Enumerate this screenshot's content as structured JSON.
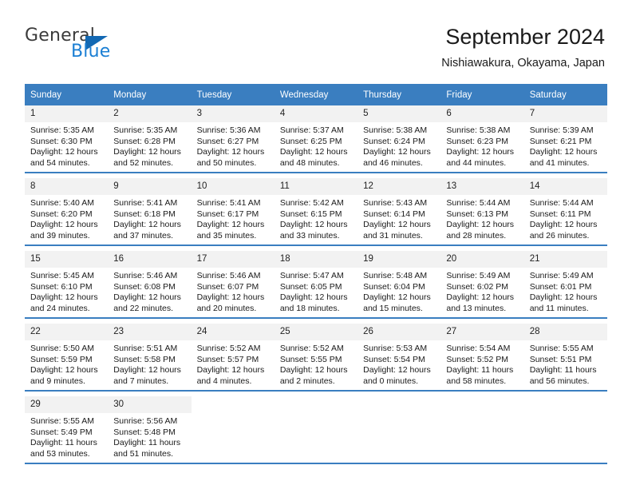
{
  "brand": {
    "name_part1": "General",
    "name_part2": "Blue",
    "triangle_icon": "triangle-icon",
    "accent_color": "#1b7fd4",
    "header_color": "#3a7ec0"
  },
  "header": {
    "title": "September 2024",
    "subtitle": "Nishiawakura, Okayama, Japan"
  },
  "weekday_headers": [
    "Sunday",
    "Monday",
    "Tuesday",
    "Wednesday",
    "Thursday",
    "Friday",
    "Saturday"
  ],
  "weeks": [
    [
      {
        "day": "1",
        "sunrise": "Sunrise: 5:35 AM",
        "sunset": "Sunset: 6:30 PM",
        "daylight1": "Daylight: 12 hours",
        "daylight2": "and 54 minutes."
      },
      {
        "day": "2",
        "sunrise": "Sunrise: 5:35 AM",
        "sunset": "Sunset: 6:28 PM",
        "daylight1": "Daylight: 12 hours",
        "daylight2": "and 52 minutes."
      },
      {
        "day": "3",
        "sunrise": "Sunrise: 5:36 AM",
        "sunset": "Sunset: 6:27 PM",
        "daylight1": "Daylight: 12 hours",
        "daylight2": "and 50 minutes."
      },
      {
        "day": "4",
        "sunrise": "Sunrise: 5:37 AM",
        "sunset": "Sunset: 6:25 PM",
        "daylight1": "Daylight: 12 hours",
        "daylight2": "and 48 minutes."
      },
      {
        "day": "5",
        "sunrise": "Sunrise: 5:38 AM",
        "sunset": "Sunset: 6:24 PM",
        "daylight1": "Daylight: 12 hours",
        "daylight2": "and 46 minutes."
      },
      {
        "day": "6",
        "sunrise": "Sunrise: 5:38 AM",
        "sunset": "Sunset: 6:23 PM",
        "daylight1": "Daylight: 12 hours",
        "daylight2": "and 44 minutes."
      },
      {
        "day": "7",
        "sunrise": "Sunrise: 5:39 AM",
        "sunset": "Sunset: 6:21 PM",
        "daylight1": "Daylight: 12 hours",
        "daylight2": "and 41 minutes."
      }
    ],
    [
      {
        "day": "8",
        "sunrise": "Sunrise: 5:40 AM",
        "sunset": "Sunset: 6:20 PM",
        "daylight1": "Daylight: 12 hours",
        "daylight2": "and 39 minutes."
      },
      {
        "day": "9",
        "sunrise": "Sunrise: 5:41 AM",
        "sunset": "Sunset: 6:18 PM",
        "daylight1": "Daylight: 12 hours",
        "daylight2": "and 37 minutes."
      },
      {
        "day": "10",
        "sunrise": "Sunrise: 5:41 AM",
        "sunset": "Sunset: 6:17 PM",
        "daylight1": "Daylight: 12 hours",
        "daylight2": "and 35 minutes."
      },
      {
        "day": "11",
        "sunrise": "Sunrise: 5:42 AM",
        "sunset": "Sunset: 6:15 PM",
        "daylight1": "Daylight: 12 hours",
        "daylight2": "and 33 minutes."
      },
      {
        "day": "12",
        "sunrise": "Sunrise: 5:43 AM",
        "sunset": "Sunset: 6:14 PM",
        "daylight1": "Daylight: 12 hours",
        "daylight2": "and 31 minutes."
      },
      {
        "day": "13",
        "sunrise": "Sunrise: 5:44 AM",
        "sunset": "Sunset: 6:13 PM",
        "daylight1": "Daylight: 12 hours",
        "daylight2": "and 28 minutes."
      },
      {
        "day": "14",
        "sunrise": "Sunrise: 5:44 AM",
        "sunset": "Sunset: 6:11 PM",
        "daylight1": "Daylight: 12 hours",
        "daylight2": "and 26 minutes."
      }
    ],
    [
      {
        "day": "15",
        "sunrise": "Sunrise: 5:45 AM",
        "sunset": "Sunset: 6:10 PM",
        "daylight1": "Daylight: 12 hours",
        "daylight2": "and 24 minutes."
      },
      {
        "day": "16",
        "sunrise": "Sunrise: 5:46 AM",
        "sunset": "Sunset: 6:08 PM",
        "daylight1": "Daylight: 12 hours",
        "daylight2": "and 22 minutes."
      },
      {
        "day": "17",
        "sunrise": "Sunrise: 5:46 AM",
        "sunset": "Sunset: 6:07 PM",
        "daylight1": "Daylight: 12 hours",
        "daylight2": "and 20 minutes."
      },
      {
        "day": "18",
        "sunrise": "Sunrise: 5:47 AM",
        "sunset": "Sunset: 6:05 PM",
        "daylight1": "Daylight: 12 hours",
        "daylight2": "and 18 minutes."
      },
      {
        "day": "19",
        "sunrise": "Sunrise: 5:48 AM",
        "sunset": "Sunset: 6:04 PM",
        "daylight1": "Daylight: 12 hours",
        "daylight2": "and 15 minutes."
      },
      {
        "day": "20",
        "sunrise": "Sunrise: 5:49 AM",
        "sunset": "Sunset: 6:02 PM",
        "daylight1": "Daylight: 12 hours",
        "daylight2": "and 13 minutes."
      },
      {
        "day": "21",
        "sunrise": "Sunrise: 5:49 AM",
        "sunset": "Sunset: 6:01 PM",
        "daylight1": "Daylight: 12 hours",
        "daylight2": "and 11 minutes."
      }
    ],
    [
      {
        "day": "22",
        "sunrise": "Sunrise: 5:50 AM",
        "sunset": "Sunset: 5:59 PM",
        "daylight1": "Daylight: 12 hours",
        "daylight2": "and 9 minutes."
      },
      {
        "day": "23",
        "sunrise": "Sunrise: 5:51 AM",
        "sunset": "Sunset: 5:58 PM",
        "daylight1": "Daylight: 12 hours",
        "daylight2": "and 7 minutes."
      },
      {
        "day": "24",
        "sunrise": "Sunrise: 5:52 AM",
        "sunset": "Sunset: 5:57 PM",
        "daylight1": "Daylight: 12 hours",
        "daylight2": "and 4 minutes."
      },
      {
        "day": "25",
        "sunrise": "Sunrise: 5:52 AM",
        "sunset": "Sunset: 5:55 PM",
        "daylight1": "Daylight: 12 hours",
        "daylight2": "and 2 minutes."
      },
      {
        "day": "26",
        "sunrise": "Sunrise: 5:53 AM",
        "sunset": "Sunset: 5:54 PM",
        "daylight1": "Daylight: 12 hours",
        "daylight2": "and 0 minutes."
      },
      {
        "day": "27",
        "sunrise": "Sunrise: 5:54 AM",
        "sunset": "Sunset: 5:52 PM",
        "daylight1": "Daylight: 11 hours",
        "daylight2": "and 58 minutes."
      },
      {
        "day": "28",
        "sunrise": "Sunrise: 5:55 AM",
        "sunset": "Sunset: 5:51 PM",
        "daylight1": "Daylight: 11 hours",
        "daylight2": "and 56 minutes."
      }
    ],
    [
      {
        "day": "29",
        "sunrise": "Sunrise: 5:55 AM",
        "sunset": "Sunset: 5:49 PM",
        "daylight1": "Daylight: 11 hours",
        "daylight2": "and 53 minutes."
      },
      {
        "day": "30",
        "sunrise": "Sunrise: 5:56 AM",
        "sunset": "Sunset: 5:48 PM",
        "daylight1": "Daylight: 11 hours",
        "daylight2": "and 51 minutes."
      },
      {
        "day": "",
        "sunrise": "",
        "sunset": "",
        "daylight1": "",
        "daylight2": ""
      },
      {
        "day": "",
        "sunrise": "",
        "sunset": "",
        "daylight1": "",
        "daylight2": ""
      },
      {
        "day": "",
        "sunrise": "",
        "sunset": "",
        "daylight1": "",
        "daylight2": ""
      },
      {
        "day": "",
        "sunrise": "",
        "sunset": "",
        "daylight1": "",
        "daylight2": ""
      },
      {
        "day": "",
        "sunrise": "",
        "sunset": "",
        "daylight1": "",
        "daylight2": ""
      }
    ]
  ]
}
